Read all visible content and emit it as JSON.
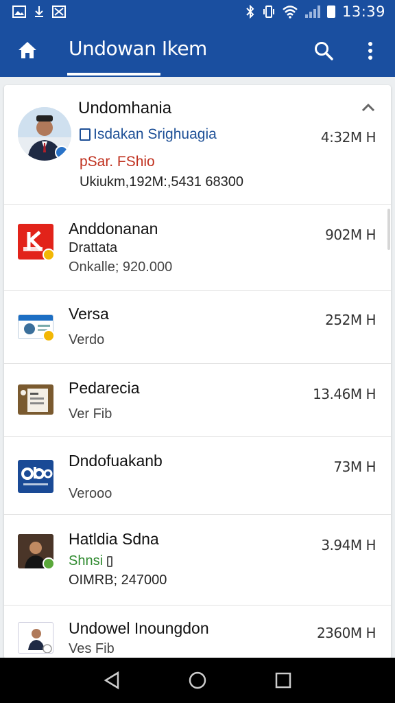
{
  "status_bar": {
    "time": "13:39",
    "left_icons": [
      "image-icon",
      "download-icon",
      "gallery-icon"
    ],
    "right_icons": [
      "bluetooth-icon",
      "vibrate-icon",
      "wifi-icon",
      "signal-icon",
      "battery-icon"
    ]
  },
  "app_bar": {
    "title": "Undowan Ikem",
    "home_icon": "home-icon",
    "search_icon": "search-icon",
    "menu_icon": "more-vert-icon",
    "color": "#1a4fa0"
  },
  "featured": {
    "title": "Undomhania",
    "line1": "Isdakan Srighuagia",
    "line2": "pSar. FShio",
    "line3": "Ukiukm,192M:,5431 68300",
    "size": "4:32M H",
    "collapse_icon": "chevron-up-icon"
  },
  "items": [
    {
      "title": "Anddonanan",
      "sub1": "Drattata",
      "sub2": "Onkalle; 920.000",
      "size": "902M H",
      "thumb_icon": "app-k-icon"
    },
    {
      "title": "Versa",
      "sub1": "Verdo",
      "size": "252M H",
      "thumb_icon": "id-card-icon"
    },
    {
      "title": "Pedarecia",
      "sub1": "Ver Fib",
      "size": "13.46M H",
      "thumb_icon": "document-icon"
    },
    {
      "title": "Dndofuakanb",
      "sub1": "Verooo",
      "size": "73M H",
      "thumb_icon": "logo-ob-icon"
    },
    {
      "title": "Hatldia Sdna",
      "sub1": "Shnsi",
      "sub2": "OIMRB; 247000",
      "size": "3.94M H",
      "thumb_icon": "person-photo-icon"
    },
    {
      "title": "Undowel Inoungdon",
      "sub1": "Ves Fib",
      "size": "2360M H",
      "thumb_icon": "person-suit-icon"
    }
  ],
  "colors": {
    "accent": "#1a4fa0",
    "link_blue": "#1d4f96",
    "red_text": "#c0311f",
    "green_text": "#2f8a2f"
  },
  "nav_bar": {
    "back_icon": "back-icon",
    "home_icon": "home-circle-icon",
    "recents_icon": "recents-icon"
  }
}
